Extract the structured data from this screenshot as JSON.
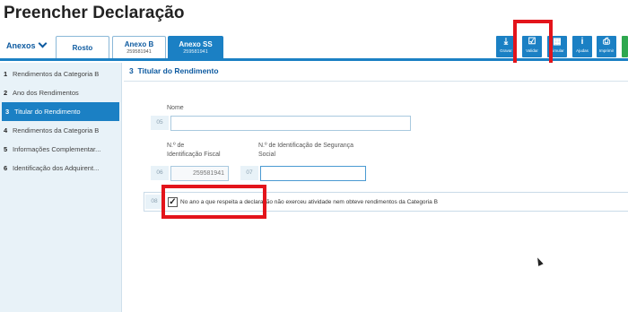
{
  "page": {
    "title": "Preencher Declaração"
  },
  "anexos_label": "Anexos",
  "tabs": [
    {
      "label": "Rosto",
      "sub": ""
    },
    {
      "label": "Anexo B",
      "sub": "259581941"
    },
    {
      "label": "Anexo SS",
      "sub": "259581941"
    }
  ],
  "toolbar": [
    {
      "label": "Gravar",
      "icon": "download-icon",
      "glyph": "⤓"
    },
    {
      "label": "Validar",
      "icon": "check-square-icon",
      "glyph": "☑"
    },
    {
      "label": "Simular",
      "icon": "calculator-icon",
      "glyph": "▦"
    },
    {
      "label": "Ajudas",
      "icon": "info-icon",
      "glyph": "i"
    },
    {
      "label": "Imprimir",
      "icon": "printer-icon",
      "glyph": "⎙"
    },
    {
      "label": "",
      "icon": "submit-icon",
      "glyph": ""
    }
  ],
  "sidebar": {
    "items": [
      {
        "num": "1",
        "label": "Rendimentos da Categoria B"
      },
      {
        "num": "2",
        "label": "Ano dos Rendimentos"
      },
      {
        "num": "3",
        "label": "Titular do Rendimento"
      },
      {
        "num": "4",
        "label": "Rendimentos da Categoria B"
      },
      {
        "num": "5",
        "label": "Informações Complementar..."
      },
      {
        "num": "6",
        "label": "Identificação dos Adquirent..."
      }
    ]
  },
  "section": {
    "num": "3",
    "title": "Titular do Rendimento"
  },
  "fields": {
    "f05": {
      "num": "05",
      "label": "Nome",
      "value": ""
    },
    "f06": {
      "num": "06",
      "label_line1": "N.º de",
      "label_line2": "Identificação Fiscal",
      "value": "259581941"
    },
    "f07": {
      "num": "07",
      "label_line1": "N.º de Identificação de Segurança",
      "label_line2": "Social",
      "value": ""
    },
    "f08": {
      "num": "08",
      "checked": true,
      "text": "No ano a que respeita a declaração não exerceu atividade nem obteve rendimentos da Categoria B"
    }
  }
}
